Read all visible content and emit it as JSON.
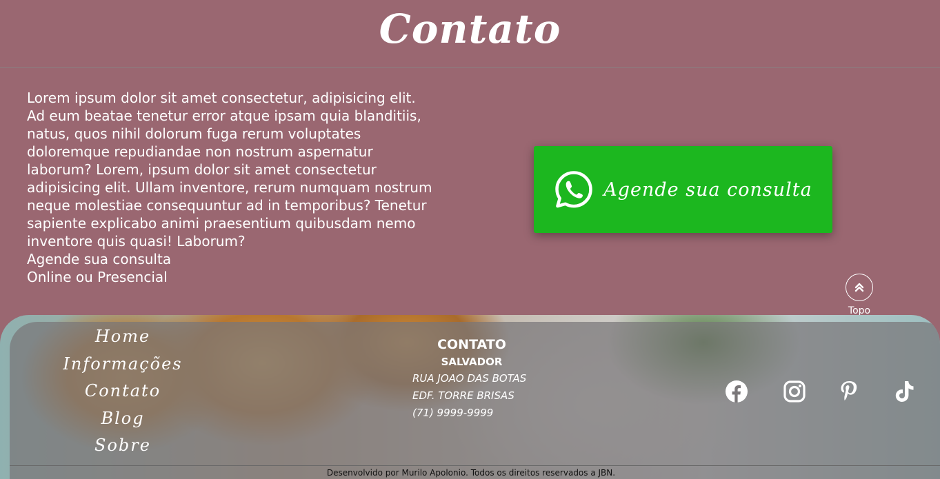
{
  "header": {
    "title": "Contato"
  },
  "intro": {
    "paragraph": "Lorem ipsum dolor sit amet consectetur, adipisicing elit. Ad eum beatae tenetur error atque ipsam quia blanditiis, natus, quos nihil dolorum fuga rerum voluptates doloremque repudiandae non nostrum aspernatur laborum? Lorem, ipsum dolor sit amet consectetur adipisicing elit. Ullam inventore, rerum numquam nostrum neque molestiae consequuntur ad in temporibus? Tenetur sapiente explicabo animi praesentium quibusdam nemo inventore quis quasi! Laborum?",
    "line_1": "Agende sua consulta",
    "line_2": "Online ou Presencial"
  },
  "whatsapp_button": {
    "label": "Agende sua consulta",
    "icon": "whatsapp-icon",
    "color": "#1cb71f"
  },
  "to_top": {
    "label": "Topo",
    "icon": "double-chevron-up-icon"
  },
  "footer": {
    "nav": [
      {
        "label": "Home"
      },
      {
        "label": "Informações"
      },
      {
        "label": "Contato"
      },
      {
        "label": "Blog"
      },
      {
        "label": "Sobre"
      }
    ],
    "contact": {
      "title": "CONTATO",
      "city": "SALVADOR",
      "address_1": "RUA JOAO DAS BOTAS",
      "address_2": "EDF. TORRE BRISAS",
      "phone": "(71) 9999-9999"
    },
    "social": [
      "facebook-icon",
      "instagram-icon",
      "pinterest-icon",
      "tiktok-icon"
    ],
    "copyright": "Desenvolvido por Murilo Apolonio. Todos os direitos reservados a JBN."
  },
  "colors": {
    "background": "#9a6771",
    "accent": "#1cb71f",
    "text": "#ffffff"
  }
}
